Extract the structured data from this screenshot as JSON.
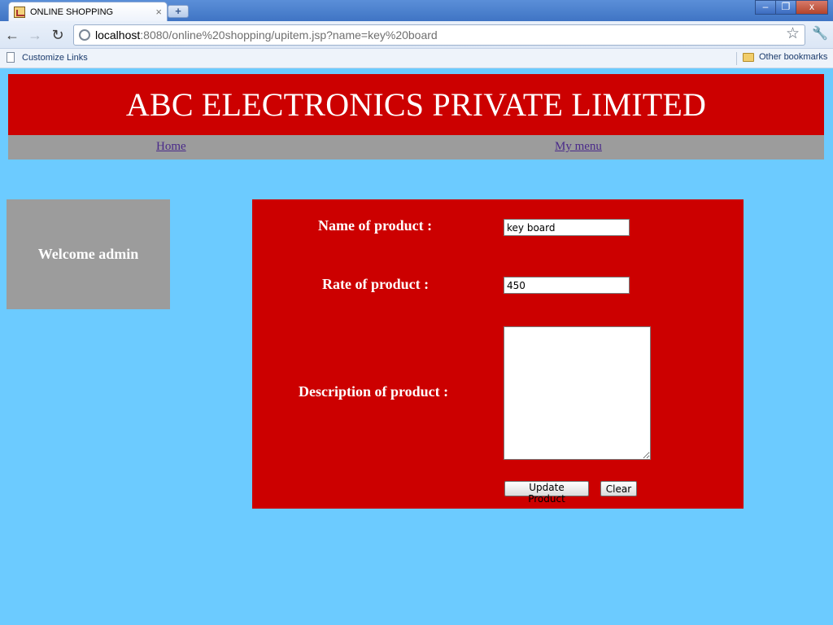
{
  "browser": {
    "tab_title": "ONLINE SHOPPING",
    "tab_close": "×",
    "new_tab": "+",
    "url_host": "localhost",
    "url_rest": ":8080/online%20shopping/upitem.jsp?name=key%20board",
    "bookmarks": {
      "left_label": "Customize Links",
      "right_label": "Other bookmarks"
    },
    "window_buttons": {
      "minimize": "–",
      "maximize": "❐",
      "close": "x"
    },
    "nav": {
      "back": "←",
      "forward": "→",
      "reload": "↻",
      "star": "☆",
      "wrench": "🔧"
    }
  },
  "page": {
    "banner_title": "ABC ELECTRONICS PRIVATE LIMITED",
    "nav_links": {
      "home": "Home",
      "my_menu": "My menu"
    },
    "welcome_text": "Welcome admin",
    "form": {
      "name_label": "Name of product :",
      "name_value": "key board",
      "rate_label": "Rate of product :",
      "rate_value": "450",
      "description_label": "Description of product :",
      "description_value": "",
      "update_button": "Update Product",
      "clear_button": "Clear"
    }
  },
  "colors": {
    "page_background": "#6ccbff",
    "brand_red": "#cc0000",
    "panel_gray": "#9c9c9c"
  }
}
